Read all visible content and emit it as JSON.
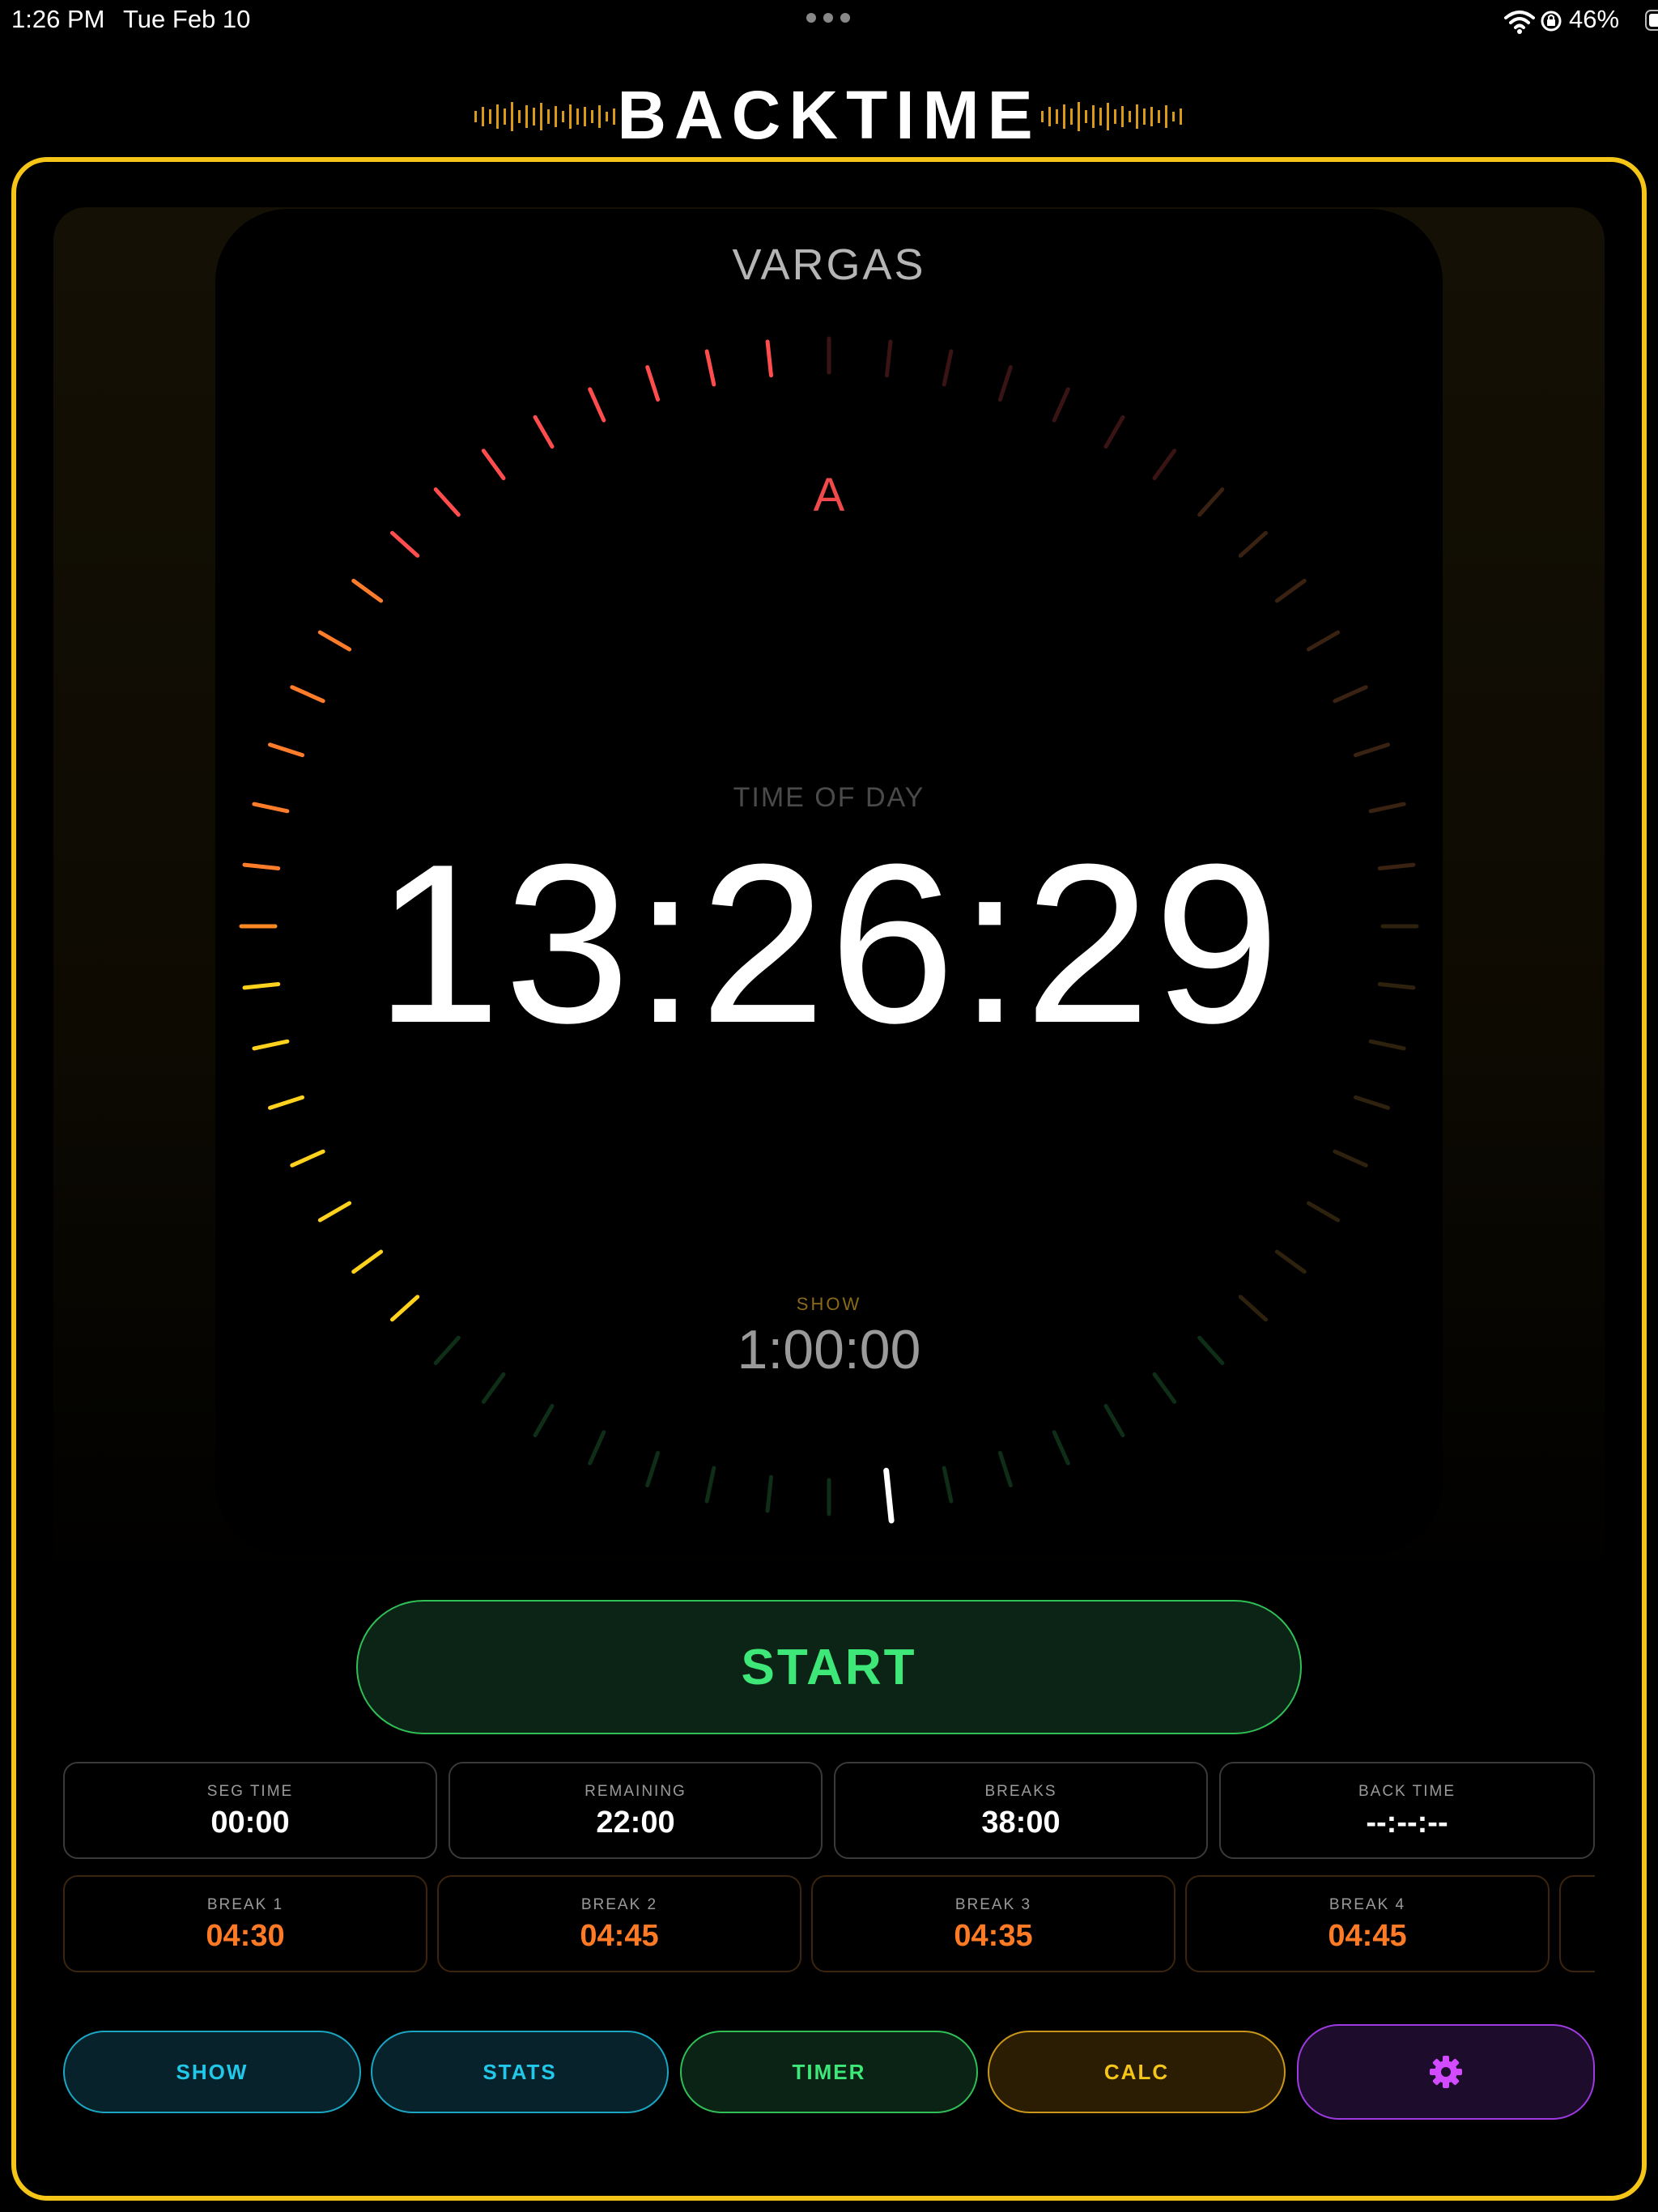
{
  "status_bar": {
    "time": "1:26 PM",
    "date": "Tue Feb 10",
    "battery_percent": "46%",
    "battery_level": 0.46,
    "icons": [
      "wifi-icon",
      "orientation-lock-icon",
      "battery-icon"
    ]
  },
  "app": {
    "title": "BACKTIME",
    "accent_color": "#f5c518"
  },
  "clock": {
    "anchor_name": "VARGAS",
    "marker_letter": "A",
    "time_of_day_label": "TIME OF DAY",
    "time_of_day": "13:26:29",
    "show_label": "SHOW",
    "show_duration": "1:00:00",
    "tick_count": 60,
    "second_hand_at_tick": 29
  },
  "controls": {
    "start_label": "START"
  },
  "stats": [
    {
      "label": "SEG TIME",
      "value": "00:00"
    },
    {
      "label": "REMAINING",
      "value": "22:00"
    },
    {
      "label": "BREAKS",
      "value": "38:00"
    },
    {
      "label": "BACK TIME",
      "value": "--:--:--"
    }
  ],
  "breaks": [
    {
      "label": "BREAK 1",
      "value": "04:30"
    },
    {
      "label": "BREAK 2",
      "value": "04:45"
    },
    {
      "label": "BREAK 3",
      "value": "04:35"
    },
    {
      "label": "BREAK 4",
      "value": "04:45"
    }
  ],
  "nav": {
    "show": "SHOW",
    "stats": "STATS",
    "timer": "TIMER",
    "calc": "CALC",
    "settings_icon": "gear-icon"
  }
}
